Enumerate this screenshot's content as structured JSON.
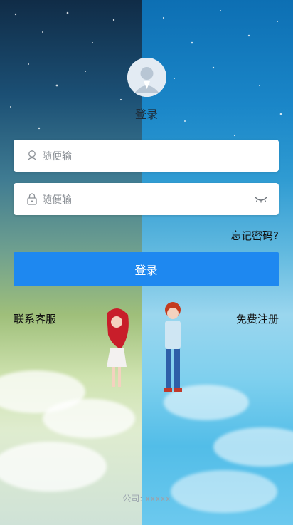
{
  "login_page": {
    "title": "登录",
    "username": {
      "placeholder": "随便输"
    },
    "password": {
      "placeholder": "随便输"
    },
    "forgot_password": "忘记密码?",
    "login_button": "登录",
    "contact_support": "联系客服",
    "register": "免费注册",
    "footer_company": "公司: xxxxx"
  },
  "colors": {
    "button_bg": "#1e88f0",
    "input_bg": "#ffffff"
  },
  "icons": [
    "avatar-icon",
    "user-icon",
    "lock-icon",
    "eye-closed-icon"
  ]
}
